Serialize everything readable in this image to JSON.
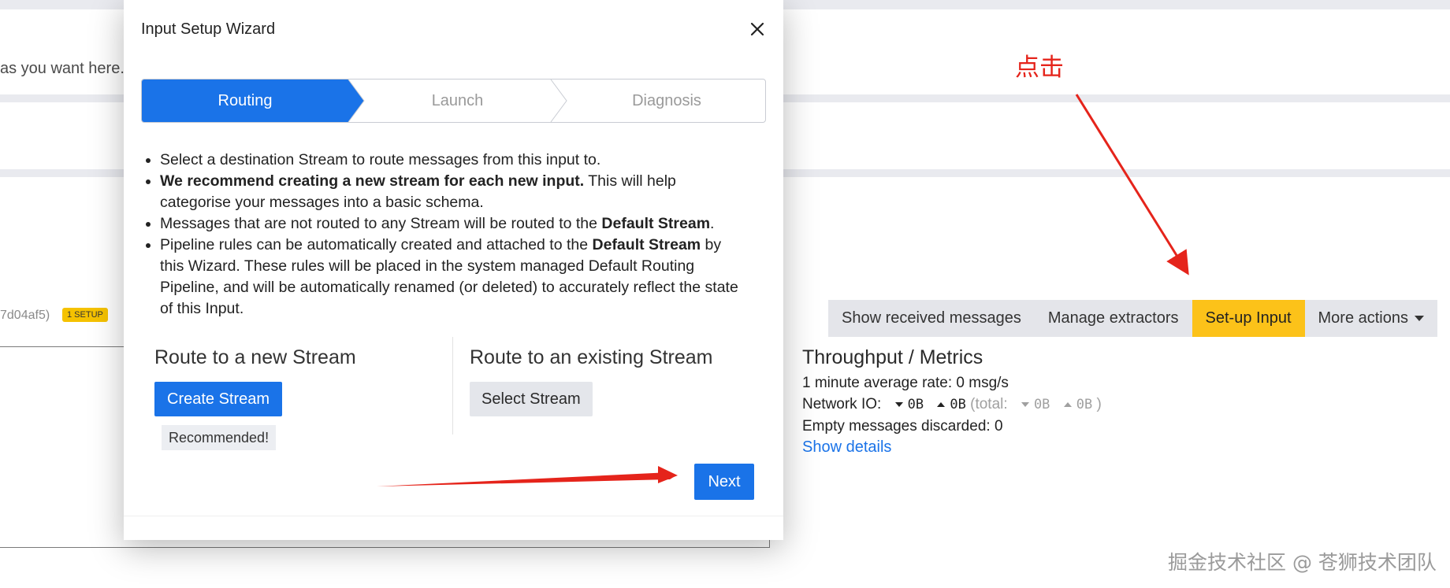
{
  "background": {
    "top_text": "as you want here.",
    "input_id": "7d04af5)",
    "setup_badge": "1 SETUP"
  },
  "actions": {
    "items": [
      "Show received messages",
      "Manage extractors",
      "Set-up Input",
      "More actions"
    ]
  },
  "metrics": {
    "title": "Throughput / Metrics",
    "avg_rate": "1 minute average rate: 0 msg/s",
    "network_label": "Network IO:",
    "network_down": "0B",
    "network_up": "0B",
    "total_label": "(total:",
    "total_down": "0B",
    "total_up": "0B",
    "total_close": ")",
    "empty_discarded": "Empty messages discarded: 0",
    "show_details": "Show details"
  },
  "annotation": {
    "click_label": "点击",
    "color": "#e5241b"
  },
  "watermark": "掘金技术社区 @ 苍狮技术团队",
  "modal": {
    "title": "Input Setup Wizard",
    "steps": [
      "Routing",
      "Launch",
      "Diagnosis"
    ],
    "active_step": "Routing",
    "bullets": [
      {
        "pre": "Select a destination Stream to route messages from this input to.",
        "bold": "",
        "post": ""
      },
      {
        "pre": "",
        "bold": "We recommend creating a new stream for each new input.",
        "post": " This will help categorise your messages into a basic schema."
      },
      {
        "pre": "Messages that are not routed to any Stream will be routed to the ",
        "bold": "Default Stream",
        "post": "."
      },
      {
        "pre": "Pipeline rules can be automatically created and attached to the ",
        "bold": "Default Stream",
        "post": " by this Wizard. These rules will be placed in the system managed Default Routing Pipeline, and will be automatically renamed (or deleted) to accurately reflect the state of this Input."
      }
    ],
    "new_stream_title": "Route to a new Stream",
    "create_button": "Create Stream",
    "recommended": "Recommended!",
    "existing_stream_title": "Route to an existing Stream",
    "select_button": "Select Stream",
    "next_button": "Next"
  },
  "colors": {
    "primary": "#1a73e8",
    "setup_yellow": "#fcc219",
    "annotation_red": "#e5241b"
  }
}
